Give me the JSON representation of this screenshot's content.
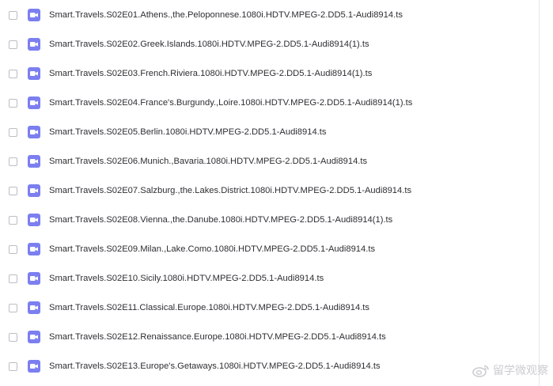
{
  "files": [
    {
      "name": "Smart.Travels.S02E01.Athens.,the.Peloponnese.1080i.HDTV.MPEG-2.DD5.1-Audi8914.ts"
    },
    {
      "name": "Smart.Travels.S02E02.Greek.Islands.1080i.HDTV.MPEG-2.DD5.1-Audi8914(1).ts"
    },
    {
      "name": "Smart.Travels.S02E03.French.Riviera.1080i.HDTV.MPEG-2.DD5.1-Audi8914(1).ts"
    },
    {
      "name": "Smart.Travels.S02E04.France's.Burgundy.,Loire.1080i.HDTV.MPEG-2.DD5.1-Audi8914(1).ts"
    },
    {
      "name": "Smart.Travels.S02E05.Berlin.1080i.HDTV.MPEG-2.DD5.1-Audi8914.ts"
    },
    {
      "name": "Smart.Travels.S02E06.Munich.,Bavaria.1080i.HDTV.MPEG-2.DD5.1-Audi8914.ts"
    },
    {
      "name": "Smart.Travels.S02E07.Salzburg.,the.Lakes.District.1080i.HDTV.MPEG-2.DD5.1-Audi8914.ts"
    },
    {
      "name": "Smart.Travels.S02E08.Vienna.,the.Danube.1080i.HDTV.MPEG-2.DD5.1-Audi8914(1).ts"
    },
    {
      "name": "Smart.Travels.S02E09.Milan.,Lake.Como.1080i.HDTV.MPEG-2.DD5.1-Audi8914.ts"
    },
    {
      "name": "Smart.Travels.S02E10.Sicily.1080i.HDTV.MPEG-2.DD5.1-Audi8914.ts"
    },
    {
      "name": "Smart.Travels.S02E11.Classical.Europe.1080i.HDTV.MPEG-2.DD5.1-Audi8914.ts"
    },
    {
      "name": "Smart.Travels.S02E12.Renaissance.Europe.1080i.HDTV.MPEG-2.DD5.1-Audi8914.ts"
    },
    {
      "name": "Smart.Travels.S02E13.Europe's.Getaways.1080i.HDTV.MPEG-2.DD5.1-Audi8914.ts"
    }
  ],
  "icons": {
    "file_type": "video-file-icon",
    "checkbox": "checkbox-unchecked"
  },
  "colors": {
    "icon_accent": "#7b7ff0",
    "text": "#2e2e33",
    "checkbox_border": "#bdbdc5"
  },
  "watermark": {
    "text": "留学微观察"
  }
}
